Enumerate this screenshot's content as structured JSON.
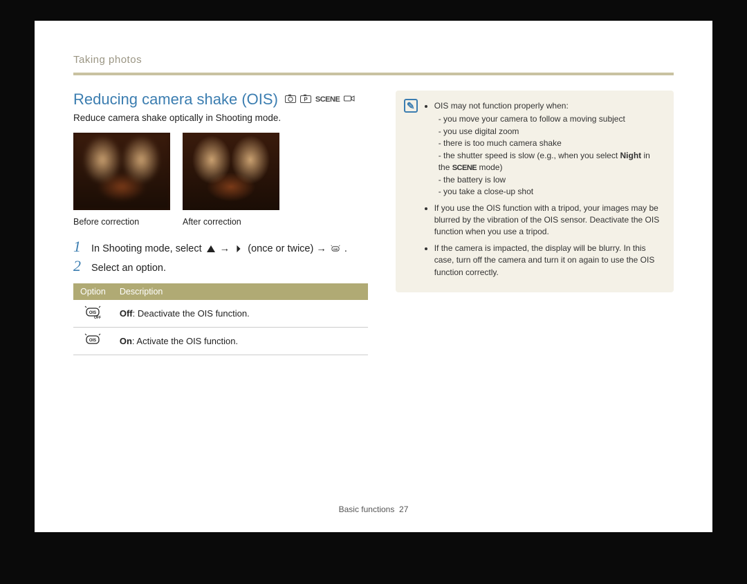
{
  "breadcrumb": "Taking photos",
  "heading": "Reducing camera shake (OIS)",
  "subtext": "Reduce camera shake optically in Shooting mode.",
  "captions": {
    "before": "Before correction",
    "after": "After correction"
  },
  "steps": {
    "s1": {
      "num": "1",
      "text_a": "In Shooting mode, select ",
      "text_b": " → ",
      "text_c": " (once or twice) → ",
      "text_d": "."
    },
    "s2": {
      "num": "2",
      "text": "Select an option."
    }
  },
  "table": {
    "h_option": "Option",
    "h_desc": "Description",
    "rows": [
      {
        "label": "Off",
        "desc": ": Deactivate the OIS function."
      },
      {
        "label": "On",
        "desc": ": Activate the OIS function."
      }
    ]
  },
  "note": {
    "lead": "OIS may not function properly when:",
    "subs": [
      "you move your camera to follow a moving subject",
      "you use digital zoom",
      "there is too much camera shake"
    ],
    "shutter_a": "the shutter speed is slow (e.g., when you select ",
    "shutter_night": "Night",
    "shutter_b": " in the ",
    "shutter_c": " mode)",
    "scene_word": "SCENE",
    "subs2": [
      "the battery is low",
      "you take a close-up shot"
    ],
    "bullet2": "If you use the OIS function with a tripod, your images may be blurred by the vibration of the OIS sensor. Deactivate the OIS function when you use a tripod.",
    "bullet3": "If the camera is impacted, the display will be blurry. In this case, turn off the camera and turn it on again to use the OIS function correctly."
  },
  "footer": {
    "section": "Basic functions",
    "page": "27"
  }
}
